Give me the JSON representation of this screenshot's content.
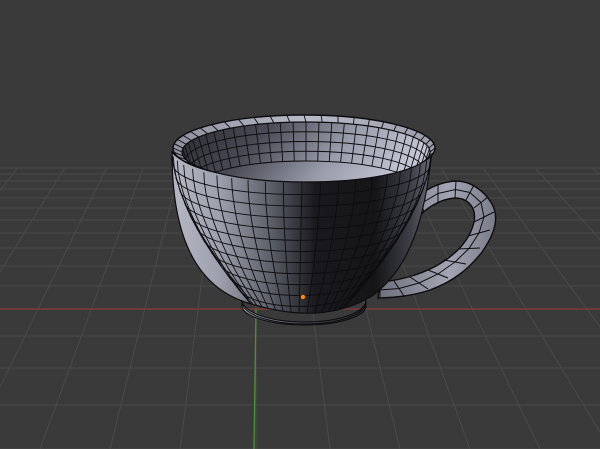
{
  "viewport": {
    "view_mode": "perspective",
    "shading": "solid",
    "overlay": "wireframe-edges",
    "grid_visible": true
  },
  "colors": {
    "background": "#3a3a3a",
    "grid_line": "#4a4a4a",
    "x_axis": "#8c3a3a",
    "y_axis": "#4f8f3a",
    "mesh_edge": "#0d0d10",
    "mesh_light": "#a8aab8",
    "mesh_dark": "#111114",
    "origin_point": "#ff8a1e"
  },
  "scene": {
    "object_type": "mesh",
    "object_shape": "teacup",
    "selected": false,
    "origin_marker_visible": true
  }
}
